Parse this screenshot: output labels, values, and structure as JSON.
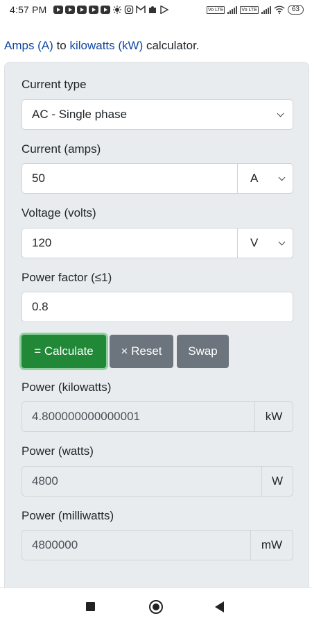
{
  "status_bar": {
    "time": "4:57 PM",
    "notification_icons": [
      "youtube-icon",
      "youtube-icon",
      "youtube-icon",
      "youtube-icon",
      "youtube-icon",
      "brightness-icon",
      "instagram-icon",
      "gmail-icon",
      "puzzle-icon",
      "play-store-icon"
    ],
    "sim1_tag": "Vo LTE",
    "sim2_tag": "Vo LTE",
    "battery": "63"
  },
  "intro": {
    "amps_link": "Amps (A)",
    "to_text": " to ",
    "kw_link": "kilowatts (kW)",
    "suffix_text": " calculator."
  },
  "form": {
    "current_type": {
      "label": "Current type",
      "selected": "AC - Single phase"
    },
    "current": {
      "label": "Current (amps)",
      "value": "50",
      "unit": "A"
    },
    "voltage": {
      "label": "Voltage (volts)",
      "value": "120",
      "unit": "V"
    },
    "power_factor": {
      "label": "Power factor (≤1)",
      "value": "0.8"
    },
    "buttons": {
      "calculate": "= Calculate",
      "reset": "× Reset",
      "swap": "Swap"
    }
  },
  "results": {
    "kilowatts": {
      "label": "Power (kilowatts)",
      "value": "4.800000000000001",
      "unit": "kW"
    },
    "watts": {
      "label": "Power (watts)",
      "value": "4800",
      "unit": "W"
    },
    "milliwatts": {
      "label": "Power (milliwatts)",
      "value": "4800000",
      "unit": "mW"
    }
  },
  "colors": {
    "link": "#0d47a1",
    "calculate_button": "#218838",
    "secondary_button": "#6c757d",
    "card_background": "#e9ecef"
  },
  "nav_bar": {
    "icons": [
      "recents-square-icon",
      "home-circle-icon",
      "back-triangle-icon"
    ]
  }
}
